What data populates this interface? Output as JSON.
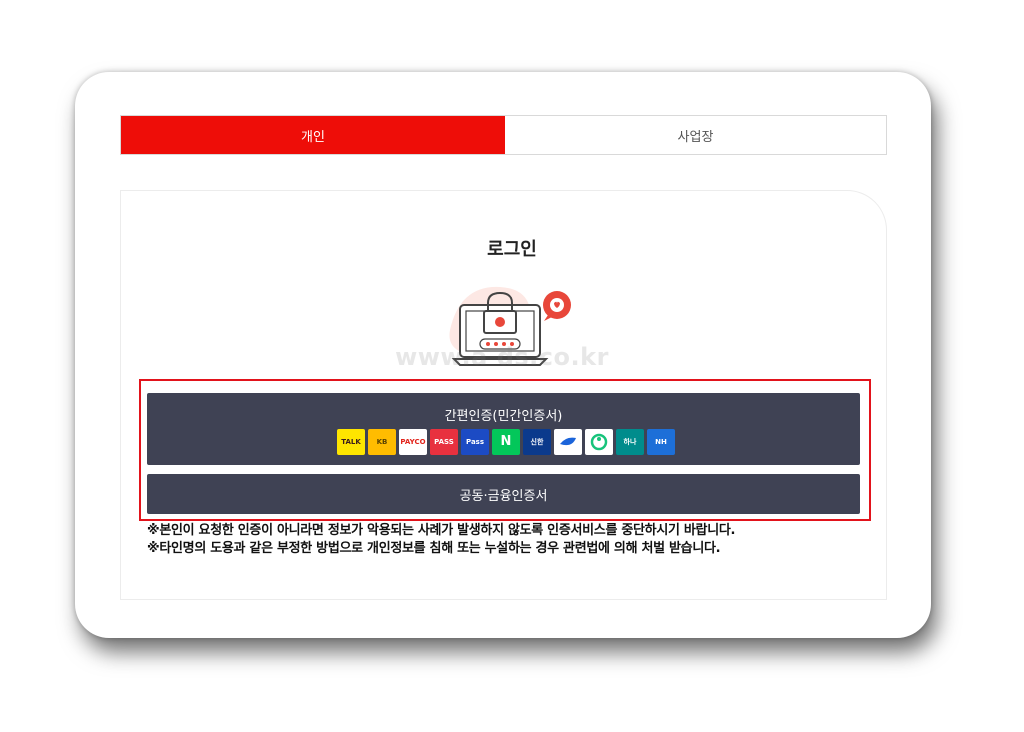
{
  "tabs": [
    {
      "label": "개인",
      "active": true
    },
    {
      "label": "사업장",
      "active": false
    }
  ],
  "login": {
    "title": "로그인",
    "watermark": "www.a   ds.co.kr"
  },
  "buttons": {
    "simple_auth": "간편인증(민간인증서)",
    "joint_cert": "공동·금융인증서"
  },
  "auth_icons": [
    {
      "name": "kakao",
      "label": "TALK",
      "color": "#fee500"
    },
    {
      "name": "kb",
      "label": "KB",
      "color": "#ffbc00"
    },
    {
      "name": "payco",
      "label": "PAYCO",
      "color": "#ffffff"
    },
    {
      "name": "pass",
      "label": "PASS",
      "color": "#e8313f"
    },
    {
      "name": "samsung-pass",
      "label": "Pass",
      "color": "#1c4bc4"
    },
    {
      "name": "naver",
      "label": "N",
      "color": "#03c75a"
    },
    {
      "name": "shinhan",
      "label": "신한",
      "color": "#0b3a8c"
    },
    {
      "name": "toss",
      "label": "",
      "color": "#ffffff"
    },
    {
      "name": "banksalad",
      "label": "",
      "color": "#ffffff"
    },
    {
      "name": "hana",
      "label": "하나",
      "color": "#008c8c"
    },
    {
      "name": "nh",
      "label": "NH",
      "color": "#1d6fd8"
    }
  ],
  "notes": [
    "※본인이 요청한 인증이 아니라면 정보가 악용되는 사례가 발생하지 않도록 인증서비스를 중단하시기 바랍니다.",
    "※타인명의 도용과 같은 부정한 방법으로 개인정보를 침해 또는 누설하는 경우 관련법에 의해 처벌 받습니다."
  ],
  "colors": {
    "accent": "#ee0d08",
    "button_bg": "#3f4254",
    "highlight_border": "#e2131b"
  }
}
